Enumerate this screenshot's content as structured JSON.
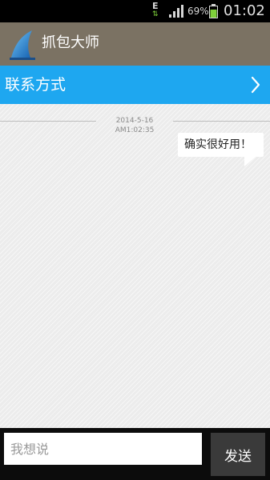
{
  "status_bar": {
    "network_type": "E",
    "data_arrows": "⇅",
    "battery_percent": "69%",
    "time": "01:02",
    "battery_color": "#7fd13b"
  },
  "app_bar": {
    "title": "抓包大师",
    "logo_icon": "shark-fin-logo",
    "background": "#7b7263"
  },
  "contact_row": {
    "label": "联系方式",
    "icon": "chevron-right-icon",
    "background": "#1ea7f0"
  },
  "chat": {
    "timestamp": "2014-5-16 AM1:02:35",
    "messages": [
      {
        "text": "确实很好用！",
        "side": "right"
      }
    ]
  },
  "composer": {
    "placeholder": "我想说",
    "value": "",
    "send_label": "发送"
  }
}
